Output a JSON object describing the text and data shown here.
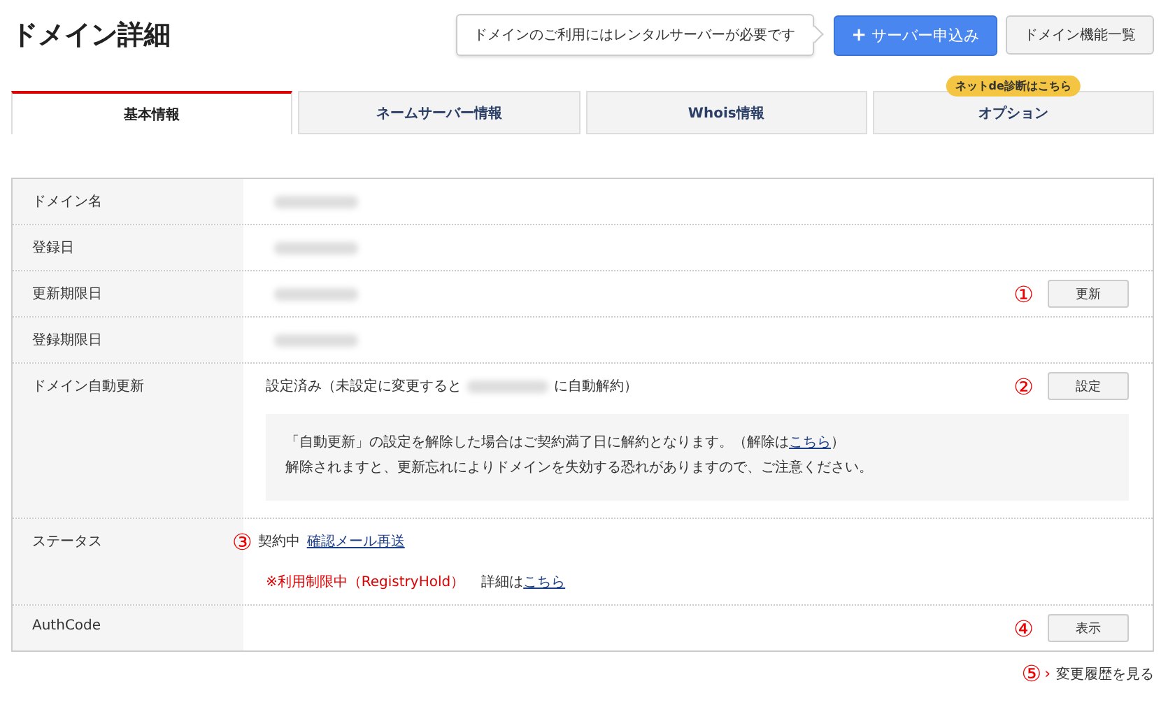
{
  "title": "ドメイン詳細",
  "header": {
    "notice": "ドメインのご利用にはレンタルサーバーが必要です",
    "primary_button": {
      "icon": "+",
      "label": "サーバー申込み"
    },
    "secondary_button": "ドメイン機能一覧"
  },
  "tabs": [
    {
      "label": "基本情報",
      "selected": true
    },
    {
      "label": "ネームサーバー情報",
      "selected": false
    },
    {
      "label": "Whois情報",
      "selected": false
    },
    {
      "label": "オプション",
      "selected": false,
      "badge": "ネットde診断はこちら"
    }
  ],
  "rows": [
    {
      "kind": "redacted",
      "label": "ドメイン名"
    },
    {
      "kind": "redacted",
      "label": "登録日"
    },
    {
      "kind": "redacted",
      "label": "更新期限日",
      "marker": "①",
      "button": "更新"
    },
    {
      "kind": "redacted",
      "label": "登録期限日"
    },
    {
      "kind": "auto_renew",
      "label": "ドメイン自動更新",
      "before": "設定済み（未設定に変更すると",
      "after": "に自動解約）",
      "marker": "②",
      "button": "設定",
      "note_line_1": "「自動更新」の設定を解除した場合はご契約満了日に解約となります。（解除は",
      "note_link": "こちら",
      "note_line_1_end": "）",
      "note_line_2": "解除されますと、更新忘れによりドメインを失効する恐れがありますので、ご注意ください。"
    },
    {
      "kind": "status",
      "label": "ステータス",
      "marker": "③",
      "state": "契約中",
      "link": "確認メール再送",
      "warning": "※利用制限中（RegistryHold）",
      "detail": "詳細は",
      "detail_link": "こちら"
    },
    {
      "kind": "button_only",
      "label": "AuthCode",
      "marker": "④",
      "button": "表示"
    }
  ],
  "footer": {
    "marker": "⑤",
    "arrow": "›",
    "link": "変更履歴を見る"
  }
}
